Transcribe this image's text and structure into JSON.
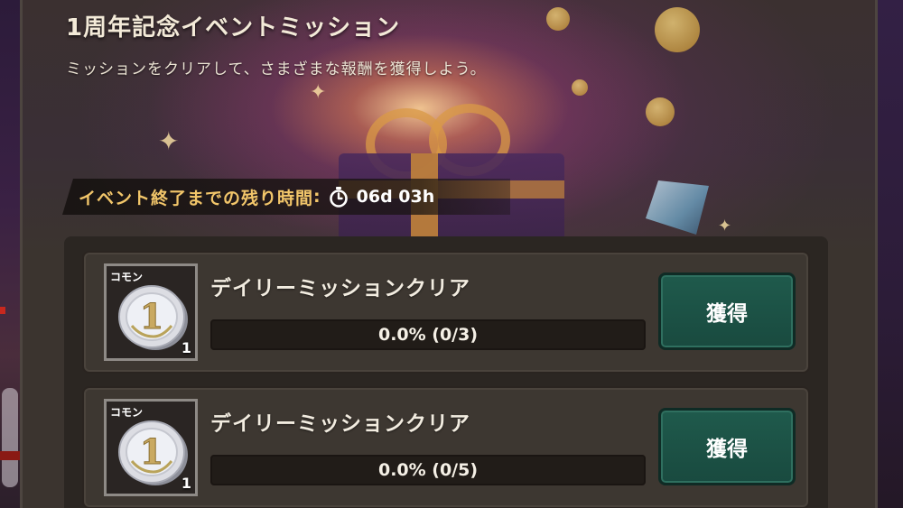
{
  "event": {
    "title": "1周年記念イベントミッション",
    "subtitle": "ミッションをクリアして、さまざまな報酬を獲得しよう。",
    "timer_label": "イベント終了までの残り時間",
    "timer_colon": ":",
    "timer_icon": "stopwatch-icon",
    "timer_value": "06d 03h"
  },
  "colors": {
    "timer_label": "#f2c66a",
    "claim_button": "#1f5a4c",
    "panel": "#3b342f"
  },
  "missions": [
    {
      "rarity": "コモン",
      "reward_icon": "silver-coin-1-icon",
      "reward_qty": "1",
      "coin_digit": "1",
      "name": "デイリーミッションクリア",
      "progress_percent": 0.0,
      "progress_text": "0.0% (0/3)",
      "button_label": "獲得"
    },
    {
      "rarity": "コモン",
      "reward_icon": "silver-coin-1-icon",
      "reward_qty": "1",
      "coin_digit": "1",
      "name": "デイリーミッションクリア",
      "progress_percent": 0.0,
      "progress_text": "0.0% (0/5)",
      "button_label": "獲得"
    }
  ]
}
